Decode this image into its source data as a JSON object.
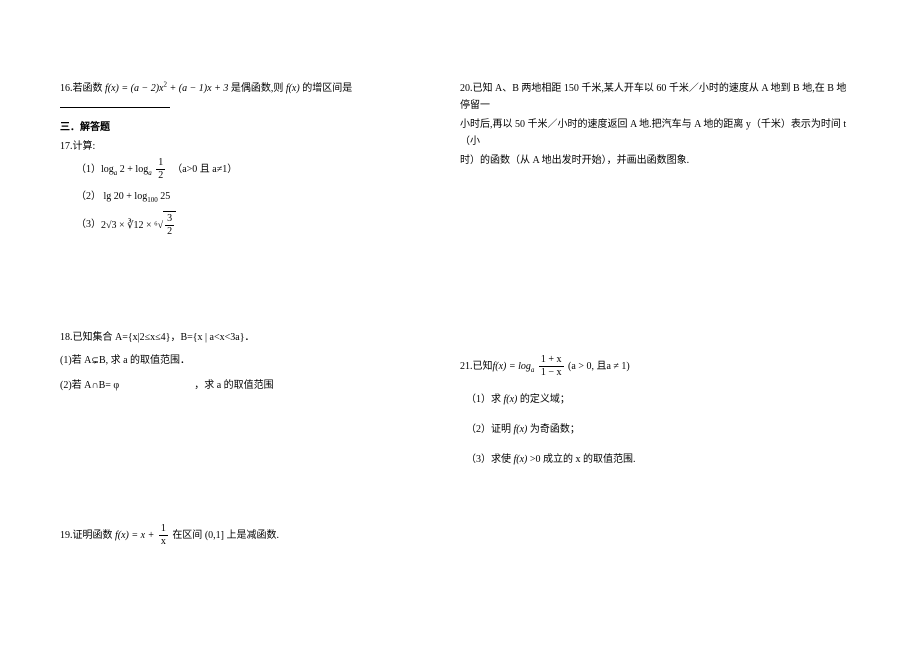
{
  "left": {
    "q16": {
      "prefix": "16.若函数",
      "expr_lhs": "f(x) = (a − 2)x",
      "expr_sup": "2",
      "expr_mid": " + (a − 1)x + 3",
      "mid": "是偶函数,则",
      "fx": "f(x)",
      "suffix": "的增区间是"
    },
    "section3": "三．解答题",
    "q17": {
      "title": "17.计算:",
      "s1_label": "（1）",
      "s1_a": "log",
      "s1_sub_a": "a",
      "s1_b": " 2 + log",
      "s1_sub_b": "a",
      "s1_frac_num": "1",
      "s1_frac_den": "2",
      "s1_cond": "（a>0 且 a≠1）",
      "s2_label": "（2）",
      "s2_a": "lg 20 + log",
      "s2_sub": "100",
      "s2_b": " 25",
      "s3_label": "（3）",
      "s3_a": "2√3 × ",
      "s3_b": "∛12",
      "s3_c": " × ",
      "s3_root6": "⁶√",
      "s3_frac_num": "3",
      "s3_frac_den": "2"
    },
    "q18": {
      "title_a": "18.已知集合 A={x|2≤x≤4}，B=",
      "title_b": "{x | a<x<3a}",
      "title_c": "．",
      "s1_label": "(1)若 A",
      "s1_sym": "⊊",
      "s1_tail": "B, 求 a 的取值范围．",
      "s2_label": "(2)若 A∩B= ",
      "s2_phi": "φ",
      "s2_tail": "，求 a 的取值范围"
    },
    "q19": {
      "prefix": "19.证明函数",
      "fx": "f(x) = x + ",
      "frac_num": "1",
      "frac_den": "x",
      "mid": " 在区间",
      "intv": "(0,1]",
      "suffix": "上是减函数."
    }
  },
  "right": {
    "q20": {
      "l1": "20.已知 A、B 两地相距 150 千米,某人开车以 60 千米／小时的速度从 A 地到 B 地,在 B 地停留一",
      "l2": "小时后,再以 50 千米／小时的速度返回 A 地.把汽车与 A 地的距离 y（千米）表示为时间 t（小",
      "l3": "时）的函数（从 A 地出发时开始），并画出函数图象."
    },
    "q21": {
      "prefix": "21.已知",
      "fx": "f(x) = log",
      "sub_a": "a",
      "frac_num": "1 + x",
      "frac_den": "1 − x",
      "cond": "(a > 0, 且a ≠ 1)",
      "s1_label": "（1）求",
      "s1_fx": "f(x)",
      "s1_tail": "的定义域；",
      "s2_label": "（2）证明",
      "s2_fx": "f(x)",
      "s2_tail": "为奇函数；",
      "s3_label": "（3）求使",
      "s3_fx": "f(x)",
      "s3_mid": ">0 成立的 x 的取值范围."
    }
  }
}
